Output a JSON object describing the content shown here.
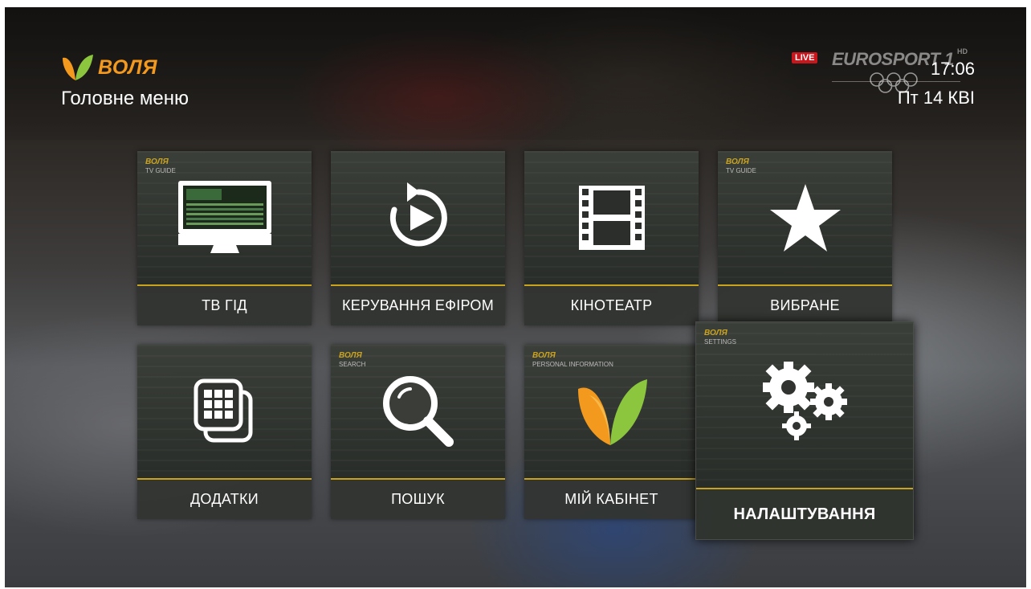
{
  "header": {
    "brand": "ВОЛЯ",
    "title": "Головне меню"
  },
  "channel": {
    "live": "LIVE",
    "name": "EUROSPORT 1",
    "hd": "HD"
  },
  "clock": {
    "time": "17:06",
    "date": "Пт 14 КВІ"
  },
  "menu": {
    "items": [
      {
        "id": "tv_guide",
        "label": "ТВ ГІД",
        "icon": "monitor-icon",
        "mini_brand": "ВОЛЯ",
        "mini_caption": "TV GUIDE"
      },
      {
        "id": "broadcast_control",
        "label": "КЕРУВАННЯ ЕФІРОМ",
        "icon": "replay-icon"
      },
      {
        "id": "cinema",
        "label": "КІНОТЕАТР",
        "icon": "film-icon"
      },
      {
        "id": "favorites",
        "label": "ВИБРАНЕ",
        "icon": "star-icon",
        "mini_brand": "ВОЛЯ",
        "mini_caption": "TV GUIDE"
      },
      {
        "id": "apps",
        "label": "ДОДАТКИ",
        "icon": "apps-icon"
      },
      {
        "id": "search",
        "label": "ПОШУК",
        "icon": "search-icon",
        "mini_brand": "ВОЛЯ",
        "mini_caption": "SEARCH"
      },
      {
        "id": "my_account",
        "label": "МІЙ КАБІНЕТ",
        "icon": "volia-logo-icon",
        "mini_brand": "ВОЛЯ",
        "mini_caption": "PERSONAL INFORMATION"
      },
      {
        "id": "settings",
        "label": "НАЛАШТУВАННЯ",
        "icon": "gears-icon",
        "mini_brand": "ВОЛЯ",
        "mini_caption": "SETTINGS",
        "focused": true
      }
    ]
  },
  "colors": {
    "brand_orange": "#f39a1e",
    "accent_gold": "#c9a21e",
    "live_red": "#c8161d"
  }
}
